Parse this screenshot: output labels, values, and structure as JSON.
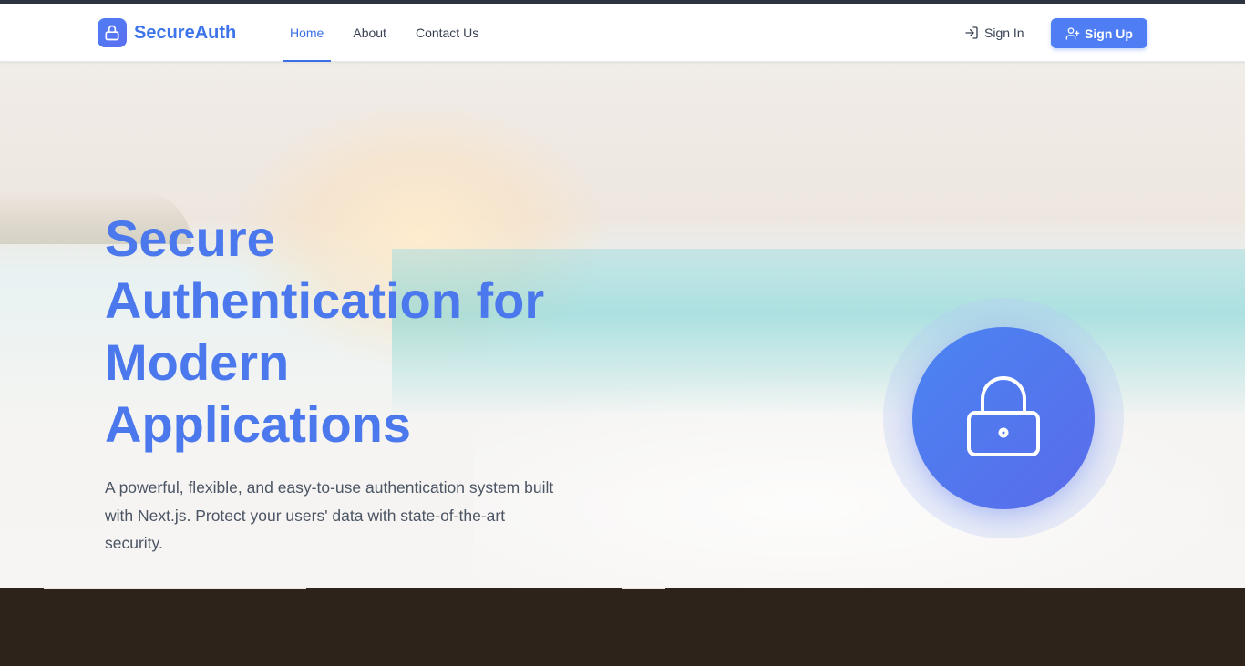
{
  "brand": {
    "name": "SecureAuth",
    "logo_icon": "lock-icon"
  },
  "nav": {
    "links": [
      {
        "label": "Home",
        "active": true
      },
      {
        "label": "About",
        "active": false
      },
      {
        "label": "Contact Us",
        "active": false
      }
    ]
  },
  "auth": {
    "signin_label": "Sign In",
    "signin_icon": "log-in-icon",
    "signup_label": "Sign Up",
    "signup_icon": "user-plus-icon"
  },
  "hero": {
    "title_lines": [
      "Secure",
      "Authentication for",
      "Modern",
      "Applications"
    ],
    "subtitle_lines": [
      "A powerful, flexible, and easy-to-use authentication system built",
      "with Next.js. Protect your users' data with state-of-the-art",
      "security."
    ],
    "illustration_icon": "lock-icon",
    "background": "beach-photo"
  },
  "colors": {
    "accent": "#4f7df3",
    "title": "#4b78ec",
    "nav_active": "#3b6fe8",
    "footer_band": "#2e231a"
  }
}
